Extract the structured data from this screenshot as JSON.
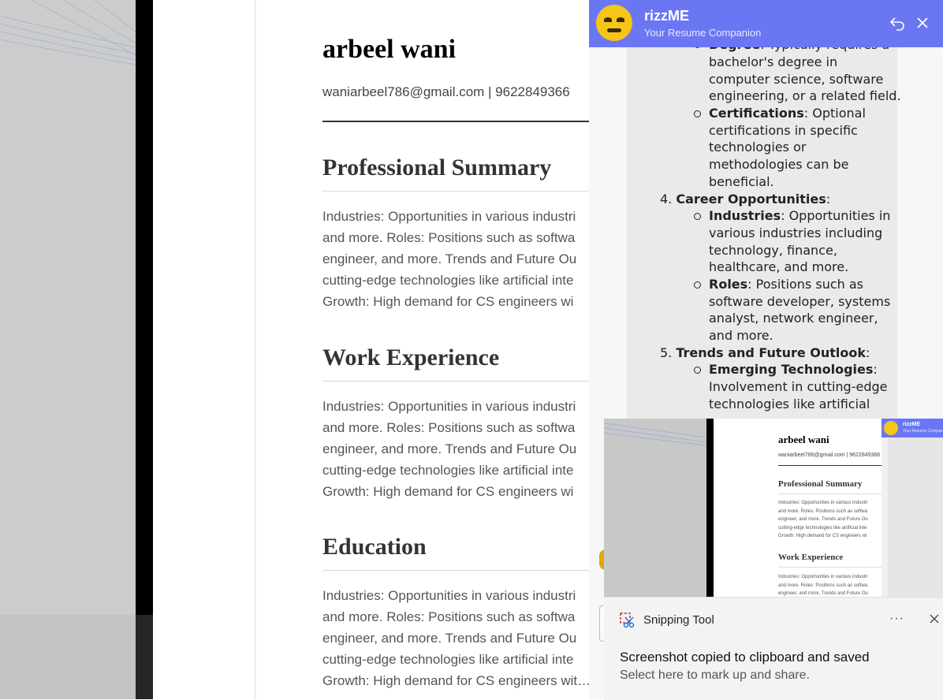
{
  "resume": {
    "name": "arbeel wani",
    "contact": "waniarbeel786@gmail.com | 9622849366",
    "sections": [
      {
        "heading": "Professional Summary",
        "lines": [
          "Industries: Opportunities in various industri",
          "and more. Roles: Positions such as softwa",
          "engineer, and more. Trends and Future Ou",
          "cutting-edge technologies like artificial inte",
          "Growth: High demand for CS engineers wi"
        ]
      },
      {
        "heading": "Work Experience",
        "lines": [
          "Industries: Opportunities in various industri",
          "and more. Roles: Positions such as softwa",
          "engineer, and more. Trends and Future Ou",
          "cutting-edge technologies like artificial inte",
          "Growth: High demand for CS engineers wi"
        ]
      },
      {
        "heading": "Education",
        "lines": [
          "Industries: Opportunities in various industri",
          "and more. Roles: Positions such as softwa",
          "engineer, and more. Trends and Future Ou",
          "cutting-edge technologies like artificial inte",
          "Growth: High demand for CS engineers wit…"
        ]
      }
    ]
  },
  "chat": {
    "title": "rizzME",
    "subtitle": "Your Resume Companion",
    "degree_label": "Degree",
    "degree_text": ": Typically requires a",
    "degree_cont": [
      "bachelor's degree in",
      "computer science, software",
      "engineering, or a related field."
    ],
    "cert_label": "Certifications",
    "cert_text": ": Optional",
    "cert_cont": [
      "certifications in specific",
      "technologies or",
      "methodologies can be",
      "beneficial."
    ],
    "item4_num": "4.",
    "item4_label": "Career Opportunities",
    "item4_colon": ":",
    "industries_label": "Industries",
    "industries_text": ": Opportunities in",
    "industries_cont": [
      "various industries including",
      "technology, finance,",
      "healthcare, and more."
    ],
    "roles_label": "Roles",
    "roles_text": ": Positions such as",
    "roles_cont": [
      "software developer, systems",
      "analyst, network engineer,",
      "and more."
    ],
    "item5_num": "5.",
    "item5_label": "Trends and Future Outlook",
    "item5_colon": ":",
    "emerging_label": "Emerging Technologies",
    "emerging_text": ":",
    "emerging_cont": [
      "Involvement in cutting-edge",
      "technologies like artificial"
    ]
  },
  "thumbnail": {
    "name": "arbeel wani",
    "contact": "waniarbeel786@gmail.com | 9622849366",
    "heading1": "Professional Summary",
    "heading2": "Work Experience",
    "lines1": [
      "Industries: Opportunities in various industri",
      "and more. Roles: Positions such as softwa",
      "engineer, and more. Trends and Future Ou",
      "cutting-edge technologies like artificial inte",
      "Growth: High demand for CS engineers wi"
    ],
    "lines2": [
      "Industries: Opportunities in various industri",
      "and more. Roles: Positions such as softwa",
      "engineer, and more. Trends and Future Ou"
    ],
    "chat_title": "rizzME",
    "chat_subtitle": "Your Resume Compan"
  },
  "toast": {
    "app_name": "Snipping Tool",
    "more": "···",
    "title": "Screenshot copied to clipboard and saved",
    "message": "Select here to mark up and share."
  },
  "colors": {
    "chat_header": "#6b77f2",
    "avatar": "#f5c518"
  },
  "icons": [
    "undo-icon",
    "close-icon",
    "snipping-tool-icon",
    "more-icon"
  ]
}
